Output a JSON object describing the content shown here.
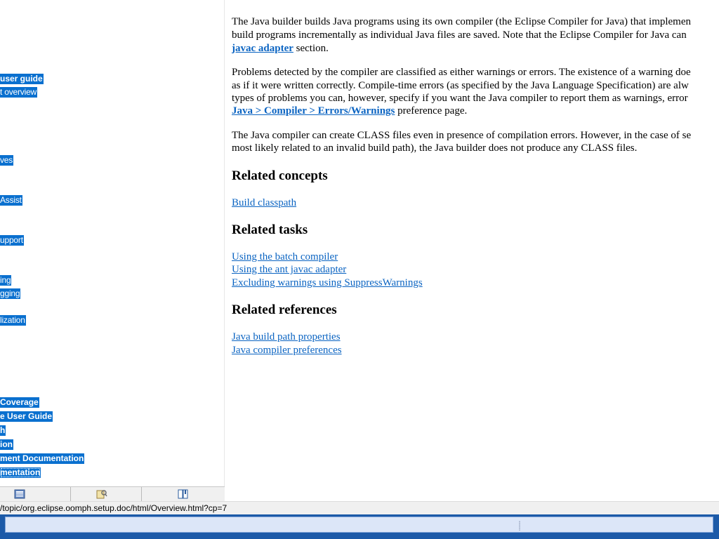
{
  "nav": {
    "highlight_color": "#0a70cf",
    "items": [
      {
        "label": "user guide",
        "bold": true
      },
      {
        "label": "t overview",
        "bold": false
      },
      {
        "label": "ves",
        "bold": false
      },
      {
        "label": "Assist",
        "bold": false
      },
      {
        "label": "upport",
        "bold": false
      },
      {
        "label": "ing",
        "bold": false
      },
      {
        "label": "gging",
        "bold": false
      },
      {
        "label": "lization",
        "bold": false
      },
      {
        "label": "Coverage",
        "bold": true
      },
      {
        "label": "e User Guide",
        "bold": true
      },
      {
        "label": "h",
        "bold": true
      },
      {
        "label": "ion",
        "bold": true
      },
      {
        "label": "ment Documentation",
        "bold": true
      },
      {
        "label": "mentation",
        "bold": true
      }
    ],
    "tabs": [
      {
        "icon": "contents-icon"
      },
      {
        "icon": "search-results-icon"
      },
      {
        "icon": "bookmarks-icon"
      }
    ]
  },
  "status": {
    "url": "/topic/org.eclipse.oomph.setup.doc/html/Overview.html?cp=7"
  },
  "content": {
    "para1": {
      "line1": "The Java builder builds Java programs using its own compiler (the Eclipse Compiler for Java) that implemen",
      "line2": "build programs incrementally as individual Java files are saved. Note that the Eclipse Compiler for Java can",
      "line3_link": "javac adapter",
      "line3_rest": " section."
    },
    "para2": {
      "line1": "Problems detected by the compiler are classified as either warnings or errors. The existence of a warning doe",
      "line2": "as if it were written correctly. Compile-time errors (as specified by the Java Language Specification) are alw",
      "line3": "types of problems you can, however, specify if you want the Java compiler to report them as warnings, error",
      "line4_link": "Java > Compiler > Errors/Warnings",
      "line4_rest": " preference page."
    },
    "para3": {
      "line1": "The Java compiler can create CLASS files even in presence of compilation errors. However, in the case of se",
      "line2": "most likely related to an invalid build path), the Java builder does not produce any CLASS files."
    },
    "related_concepts": {
      "heading": "Related concepts",
      "links": [
        "Build classpath"
      ]
    },
    "related_tasks": {
      "heading": "Related tasks",
      "links": [
        "Using the batch compiler",
        "Using the ant javac adapter",
        "Excluding warnings using SuppressWarnings"
      ]
    },
    "related_references": {
      "heading": "Related references",
      "links": [
        "Java build path properties",
        "Java compiler preferences"
      ]
    }
  }
}
